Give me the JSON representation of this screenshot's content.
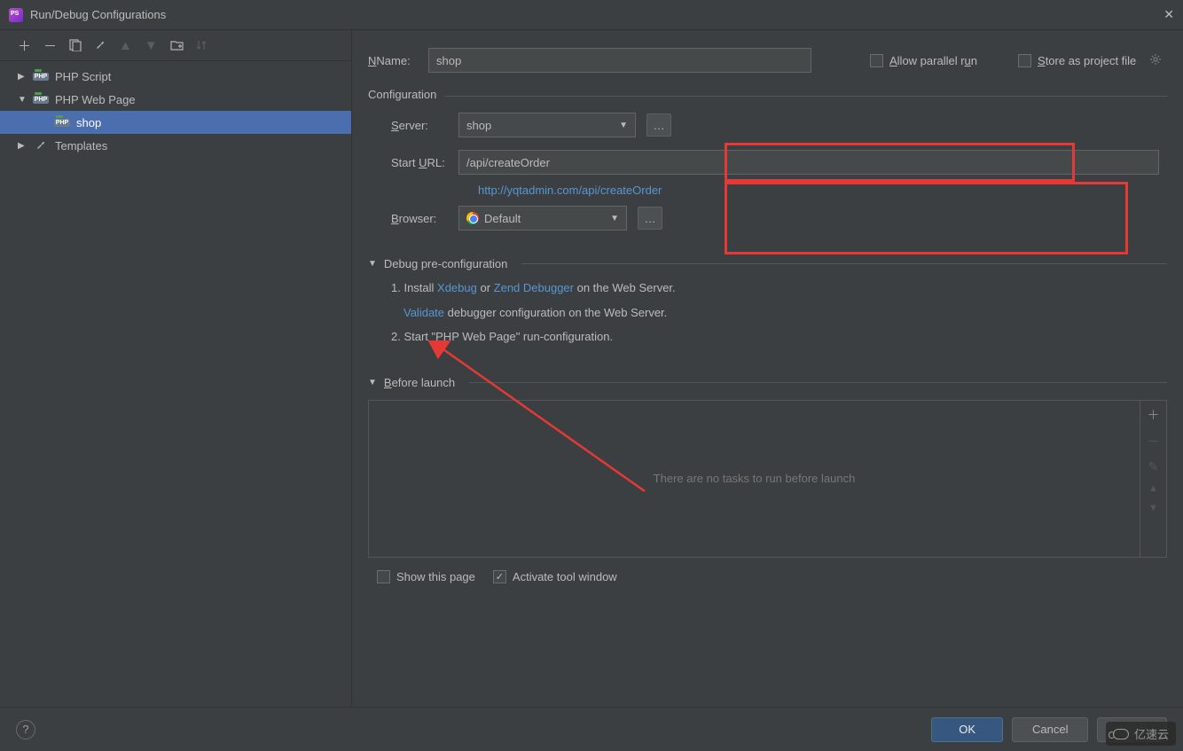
{
  "window": {
    "title": "Run/Debug Configurations"
  },
  "tree": {
    "php_script": "PHP Script",
    "php_web_page": "PHP Web Page",
    "shop": "shop",
    "templates": "Templates"
  },
  "name_row": {
    "label": "Name:",
    "value": "shop"
  },
  "options": {
    "allow_parallel": "Allow parallel run",
    "store_as_project": "Store as project file"
  },
  "configuration": {
    "title": "Configuration",
    "server_label": "Server:",
    "server_value": "shop",
    "start_url_label": "Start URL:",
    "start_url_value": "/api/createOrder",
    "resolved_url": "http://yqtadmin.com/api/createOrder",
    "browser_label": "Browser:",
    "browser_value": "Default"
  },
  "debug": {
    "title": "Debug pre-configuration",
    "step1_a": "1. Install ",
    "xdebug": "Xdebug",
    "or": " or ",
    "zend": "Zend Debugger",
    "step1_b": " on the Web Server.",
    "validate": "Validate",
    "validate_rest": " debugger configuration on the Web Server.",
    "step2": "2. Start \"PHP Web Page\" run-configuration."
  },
  "before_launch": {
    "title": "Before launch",
    "empty": "There are no tasks to run before launch"
  },
  "bottom": {
    "show_page": "Show this page",
    "activate_tool": "Activate tool window"
  },
  "footer": {
    "ok": "OK",
    "cancel": "Cancel",
    "apply": "Apply"
  },
  "watermark": "亿速云"
}
